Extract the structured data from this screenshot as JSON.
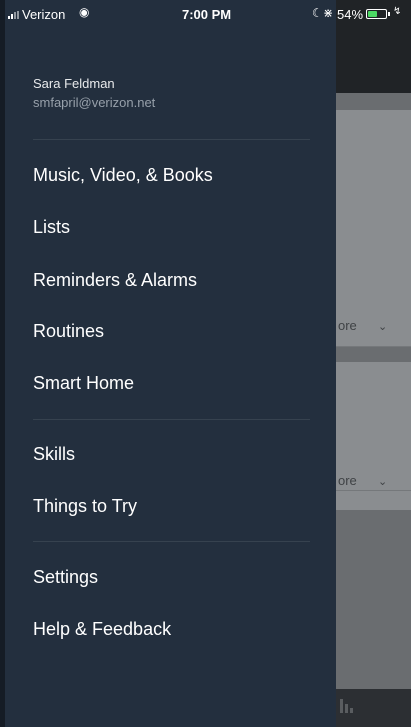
{
  "status_bar": {
    "carrier": "Verizon",
    "time": "7:00 PM",
    "battery_percent": "54%",
    "battery_level": 0.54
  },
  "profile": {
    "name": "Sara Feldman",
    "email": "smfapril@verizon.net"
  },
  "menu": {
    "music": "Music, Video, & Books",
    "lists": "Lists",
    "reminders": "Reminders & Alarms",
    "routines": "Routines",
    "smart_home": "Smart Home",
    "skills": "Skills",
    "things_to_try": "Things to Try",
    "settings": "Settings",
    "help": "Help & Feedback"
  },
  "background": {
    "more_1": "ore",
    "more_2": "ore"
  },
  "colors": {
    "drawer_bg": "#232f3e",
    "battery_green": "#4cd964"
  }
}
